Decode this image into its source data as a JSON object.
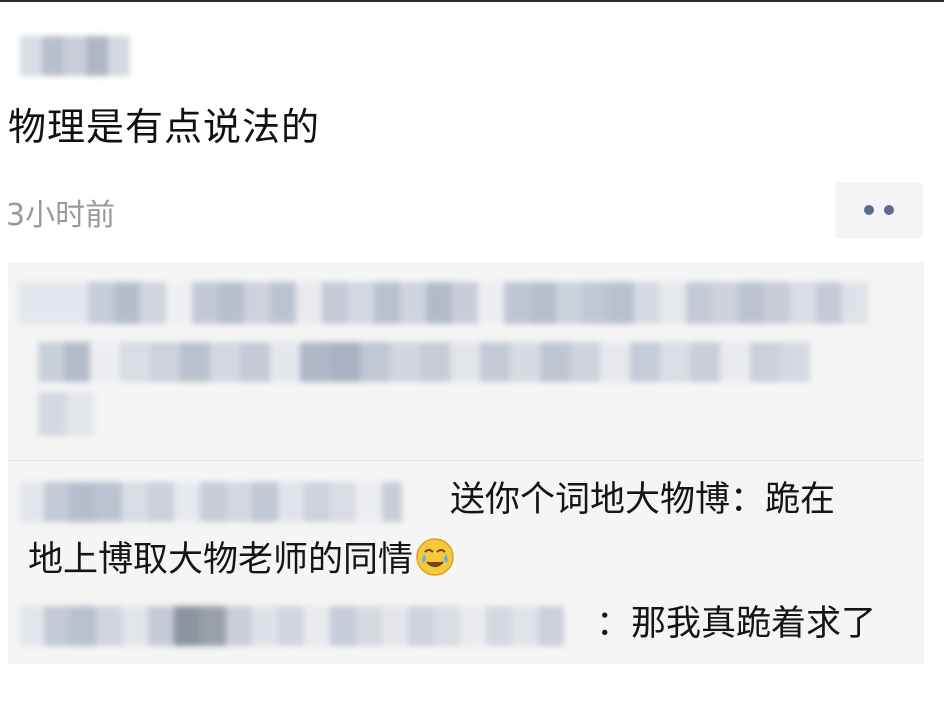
{
  "post": {
    "text": "物理是有点说法的",
    "time": "3小时前"
  },
  "comments": [
    {
      "line1": "送你个词地大物博：跪在",
      "line2": "地上博取大物老师的同情",
      "emoji_icon": "face-with-tears-emoji"
    },
    {
      "text": "：那我真跪着求了"
    }
  ],
  "colors": {
    "panel_background": "#f5f5f5",
    "name_link": "#5c6b8a",
    "time_gray": "#9a9a9a"
  }
}
